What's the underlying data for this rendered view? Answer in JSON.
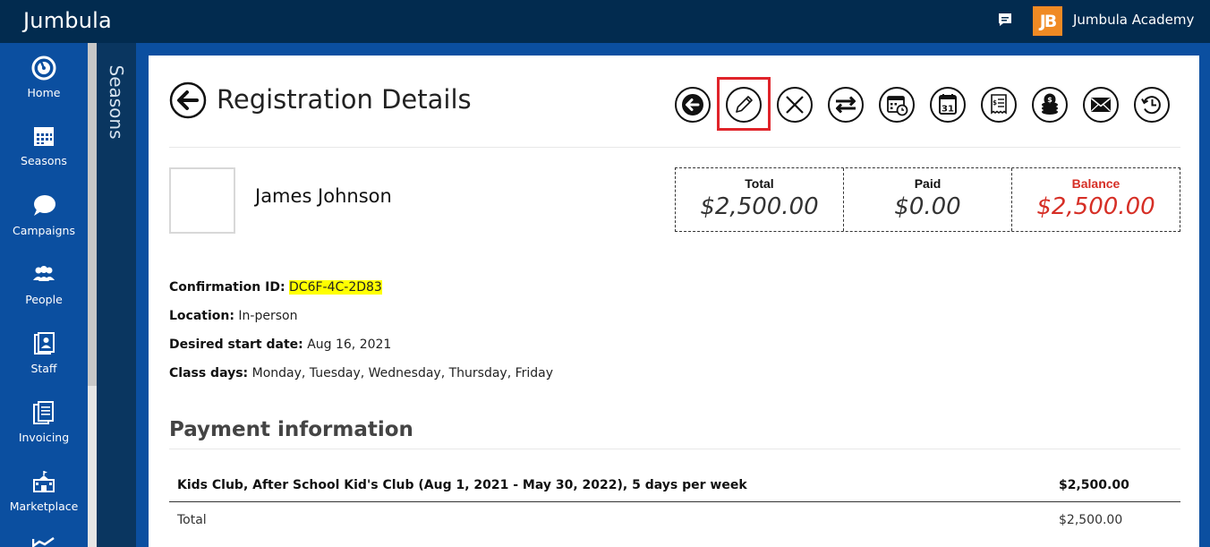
{
  "app": {
    "brand": "Jumbula",
    "org_logo_text": "JB",
    "org_name": "Jumbula Academy"
  },
  "sidebar": {
    "items": [
      {
        "label": "Home",
        "icon": "gauge-icon"
      },
      {
        "label": "Seasons",
        "icon": "calendar-icon"
      },
      {
        "label": "Campaigns",
        "icon": "chat-bubbles-icon"
      },
      {
        "label": "People",
        "icon": "people-icon"
      },
      {
        "label": "Staff",
        "icon": "staff-badge-icon"
      },
      {
        "label": "Invoicing",
        "icon": "invoice-icon"
      },
      {
        "label": "Marketplace",
        "icon": "school-building-icon"
      }
    ],
    "panel_label": "Seasons"
  },
  "page": {
    "title": "Registration Details"
  },
  "toolbar": {
    "buttons": [
      {
        "name": "back-circle-button",
        "icon": "arrow-left-circle-icon"
      },
      {
        "name": "edit-button",
        "icon": "pencil-icon",
        "highlighted": true
      },
      {
        "name": "cancel-button",
        "icon": "x-icon"
      },
      {
        "name": "transfer-button",
        "icon": "swap-arrows-icon"
      },
      {
        "name": "schedule-button",
        "icon": "calendar-clock-icon"
      },
      {
        "name": "calendar-button",
        "icon": "calendar-31-icon"
      },
      {
        "name": "invoice-button",
        "icon": "receipt-icon"
      },
      {
        "name": "payment-button",
        "icon": "coins-icon"
      },
      {
        "name": "email-button",
        "icon": "envelope-icon"
      },
      {
        "name": "history-button",
        "icon": "history-icon"
      }
    ],
    "calendar_day": "31",
    "highlight_color": "#e0242a"
  },
  "person": {
    "name": "James Johnson"
  },
  "summary": {
    "total_label": "Total",
    "total_value": "$2,500.00",
    "paid_label": "Paid",
    "paid_value": "$0.00",
    "balance_label": "Balance",
    "balance_value": "$2,500.00",
    "balance_color": "#d62f26"
  },
  "details": {
    "confirmation_label": "Confirmation ID:",
    "confirmation_value": "DC6F-4C-2D83",
    "location_label": "Location:",
    "location_value": "In-person",
    "start_label": "Desired start date:",
    "start_value": "Aug 16, 2021",
    "days_label": "Class days:",
    "days_value": "Monday, Tuesday, Wednesday, Thursday, Friday"
  },
  "payment": {
    "section_title": "Payment information",
    "line_desc": "Kids Club, After School Kid's Club (Aug 1, 2021 - May 30, 2022), 5 days per week",
    "line_amount": "$2,500.00",
    "total_label": "Total",
    "total_amount": "$2,500.00"
  },
  "colors": {
    "topbar": "#022b4f",
    "sidebar": "#0b4fa0",
    "accent_orange": "#f08a24",
    "highlight_yellow": "#ffff00"
  }
}
